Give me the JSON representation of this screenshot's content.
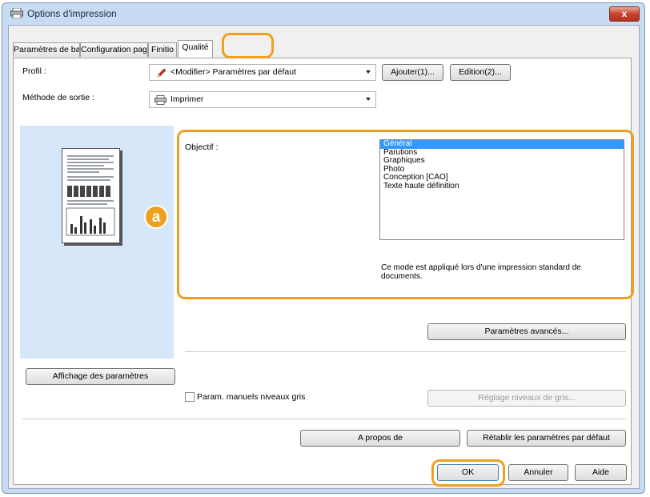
{
  "window": {
    "title": "Options d'impression",
    "close_glyph": "x"
  },
  "tabs": [
    {
      "label": "Paramètres de base"
    },
    {
      "label": "Configuration page"
    },
    {
      "label": "Finitio"
    },
    {
      "label": "Qualité"
    }
  ],
  "profile": {
    "label": "Profil :",
    "value": "<Modifier> Paramètres par défaut",
    "icon": "pencil-icon",
    "add_button": "Ajouter(1)...",
    "edit_button": "Edition(2)..."
  },
  "output": {
    "label": "Méthode de sortie :",
    "value": "Imprimer",
    "icon": "printer-icon"
  },
  "callout_badge": "a",
  "objective": {
    "label": "Objectif :",
    "options": [
      "Général",
      "Parutions",
      "Graphiques",
      "Photo",
      "Conception [CAO]",
      "Texte haute définition"
    ],
    "selected": "Général",
    "description": "Ce mode est appliqué lors d'une impression standard de documents."
  },
  "advanced_button": "Paramètres avancés...",
  "display_settings_button": "Affichage des paramètres",
  "gray_manual_label": "Param. manuels niveaux gris",
  "gray_adjust_button": "Réglage niveaux de gris...",
  "about_button": "A propos de",
  "reset_button": "Rétablir les paramètres par défaut",
  "ok_button": "OK",
  "cancel_button": "Annuler",
  "help_button": "Aide",
  "colors": {
    "highlight": "#f0a020",
    "selection": "#3399ff",
    "preview_bg": "#d7e7fa"
  }
}
